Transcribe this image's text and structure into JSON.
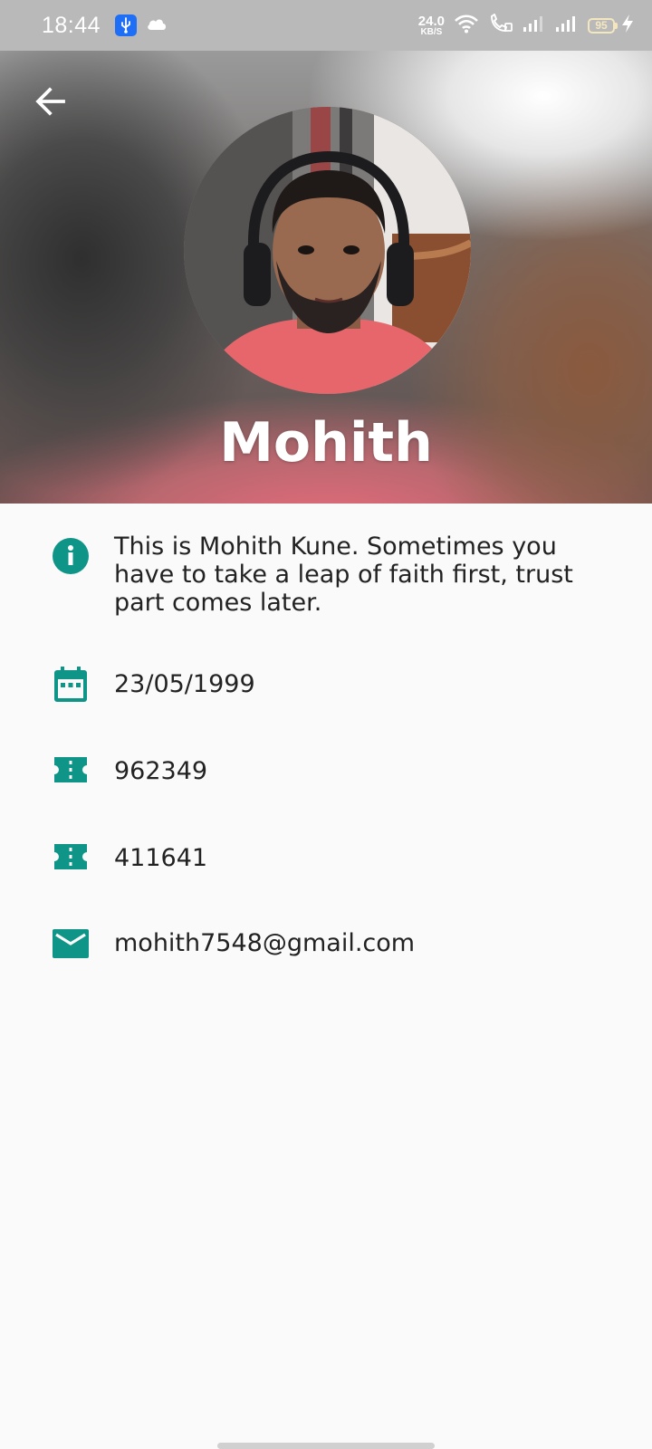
{
  "status_bar": {
    "time": "18:44",
    "net_speed_value": "24.0",
    "net_speed_unit": "KB/S",
    "battery_level": "95",
    "icons": [
      "usb-icon",
      "cloud-icon",
      "wifi-icon",
      "wifi-calling-icon",
      "signal-icon",
      "signal-icon",
      "battery-icon",
      "charging-icon"
    ]
  },
  "header": {
    "back_icon": "arrow-back-icon",
    "name": "Mohith"
  },
  "details": {
    "accent_color": "#0f9488",
    "items": [
      {
        "icon": "info-icon",
        "text": "This is Mohith Kune. Sometimes you have to take a leap of faith first, trust part comes later."
      },
      {
        "icon": "calendar-icon",
        "text": "23/05/1999"
      },
      {
        "icon": "ticket-icon",
        "text": "962349"
      },
      {
        "icon": "ticket-icon",
        "text": "411641"
      },
      {
        "icon": "email-icon",
        "text": "mohith7548@gmail.com"
      }
    ]
  }
}
